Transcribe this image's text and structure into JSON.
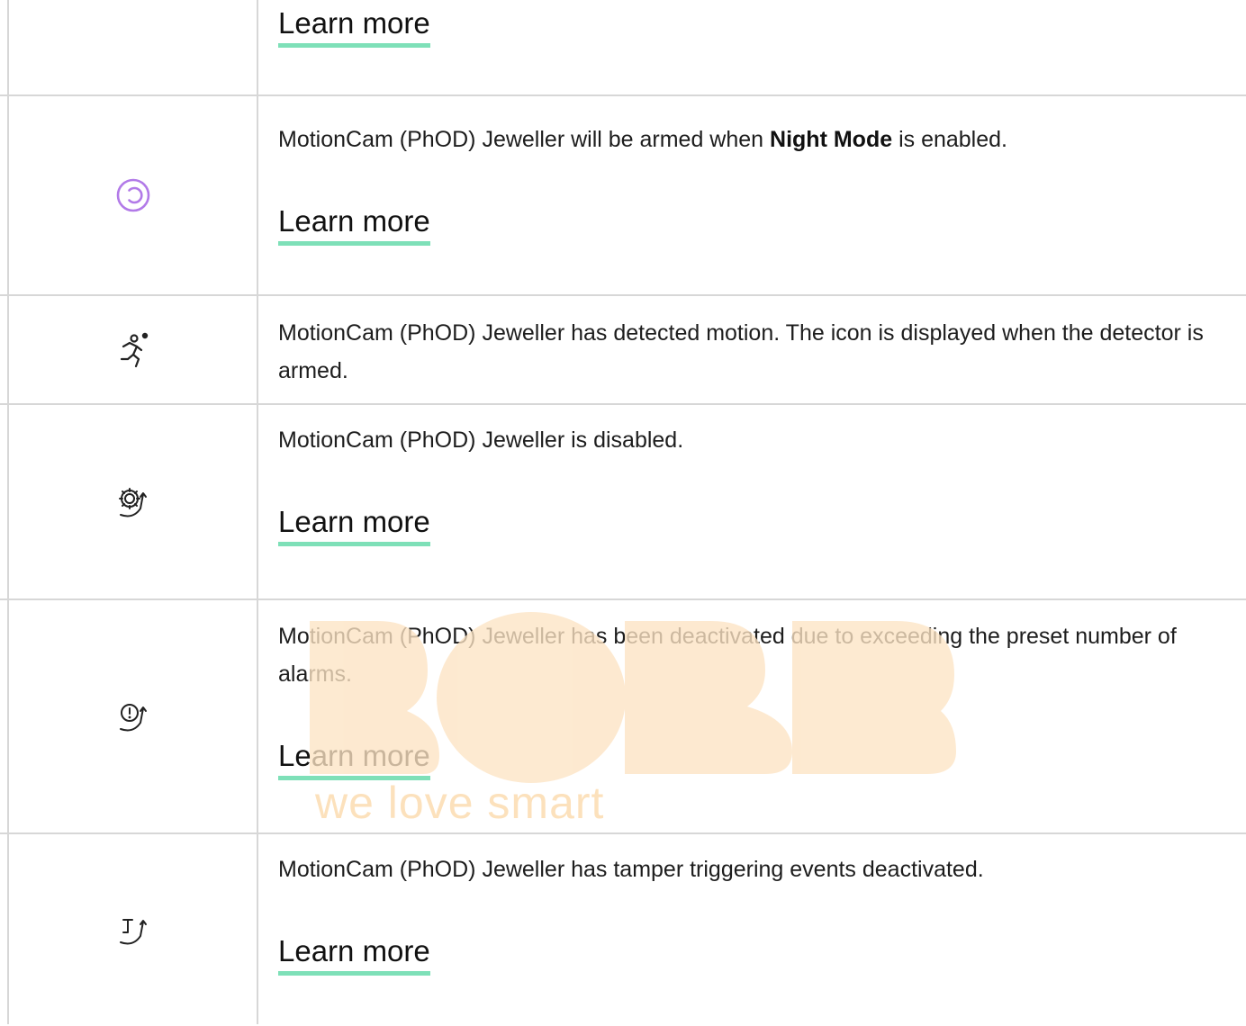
{
  "rows": [
    {
      "learn_more": "Learn more"
    },
    {
      "icon": "night-mode-icon",
      "icon_color": "#b27ae8",
      "text_before": "MotionCam (PhOD) Jeweller will be armed when ",
      "text_bold": "Night Mode",
      "text_after": " is enabled.",
      "learn_more": "Learn more"
    },
    {
      "icon": "motion-detected-icon",
      "text": "MotionCam (PhOD) Jeweller has detected motion. The icon is displayed when the detector is armed."
    },
    {
      "icon": "device-disabled-icon",
      "text": "MotionCam (PhOD) Jeweller is disabled.",
      "learn_more": "Learn more"
    },
    {
      "icon": "alarm-deactivated-icon",
      "text": "MotionCam (PhOD) Jeweller has been deactivated due to exceeding the preset number of alarms.",
      "learn_more": "Learn more"
    },
    {
      "icon": "tamper-deactivated-icon",
      "text": "MotionCam (PhOD) Jeweller has tamper triggering events deactivated.",
      "learn_more": "Learn more"
    }
  ],
  "colors": {
    "link_underline": "#7ee0b8",
    "border": "#d7d7d7",
    "watermark": "#fde4c4"
  },
  "watermark": {
    "tagline": "we love smart"
  }
}
